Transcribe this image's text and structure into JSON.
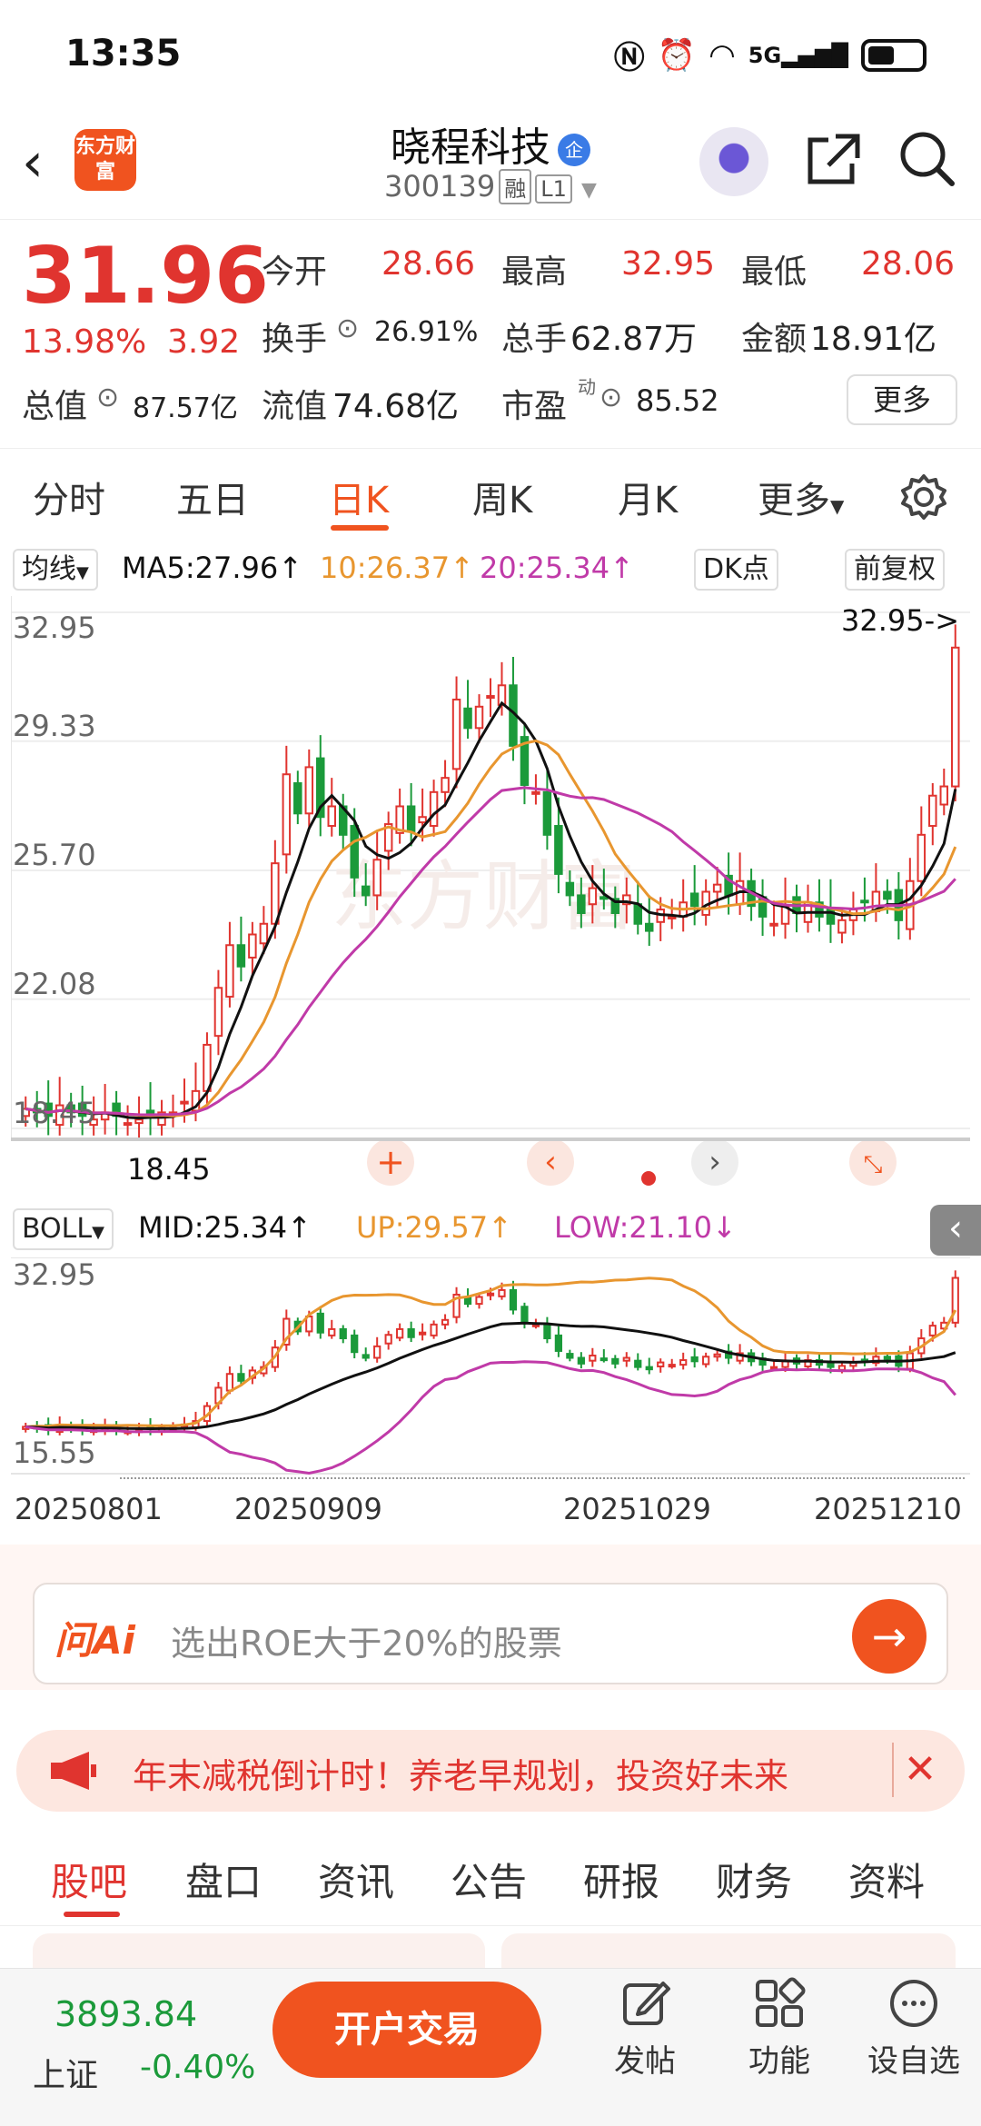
{
  "status_bar": {
    "time": "13:35",
    "icons": [
      "nfc-icon",
      "alarm-icon",
      "wifi-icon",
      "5g-signal-icon",
      "battery-icon"
    ],
    "network": "5G"
  },
  "header": {
    "logo_text": "东方财富",
    "name": "晓程科技",
    "name_badge": "企",
    "code": "300139",
    "tags": [
      "融",
      "L1"
    ]
  },
  "quote": {
    "price": "31.96",
    "change_pct": "13.98%",
    "change": "3.92",
    "fields": [
      {
        "label": "今开",
        "value": "28.66"
      },
      {
        "label": "最高",
        "value": "32.95"
      },
      {
        "label": "最低",
        "value": "28.06"
      },
      {
        "label": "换手",
        "value": "26.91%"
      },
      {
        "label": "总手",
        "value": "62.87万"
      },
      {
        "label": "金额",
        "value": "18.91亿"
      },
      {
        "label": "总值",
        "value": "87.57亿"
      },
      {
        "label": "流值",
        "value": "74.68亿"
      },
      {
        "label": "市盈",
        "sup": "动",
        "value": "85.52"
      }
    ],
    "more": "更多"
  },
  "period_tabs": [
    "分时",
    "五日",
    "日K",
    "周K",
    "月K",
    "更多"
  ],
  "active_period": "日K",
  "ma_bar": {
    "selector": "均线",
    "ma5": "MA5:27.96↑",
    "ma10": "10:26.37↑",
    "ma20": "20:25.34↑",
    "dk": "DK点",
    "adjust": "前复权"
  },
  "boll_bar": {
    "selector": "BOLL",
    "mid": "MID:25.34↑",
    "up": "UP:29.57↑",
    "low": "LOW:21.10↓"
  },
  "colors": {
    "up": "#e0342f",
    "down": "#1b9a3a",
    "ma5": "#111111",
    "ma10": "#e8962f",
    "ma20": "#c03aa8",
    "accent": "#f0531f"
  },
  "chart_data": [
    {
      "type": "candlestick",
      "title": "日K",
      "y_ticks": [
        "32.95",
        "29.33",
        "25.70",
        "22.08",
        "18.45"
      ],
      "ylim": [
        18.45,
        32.95
      ],
      "high_marker": "32.95->",
      "low_marker": "18.45",
      "watermark": "东方财富",
      "close": [
        19.0,
        18.9,
        18.8,
        19.1,
        18.9,
        18.8,
        18.7,
        18.9,
        18.8,
        18.6,
        18.7,
        18.8,
        18.9,
        18.9,
        19.2,
        19.5,
        20.8,
        22.4,
        23.6,
        23.0,
        23.9,
        24.2,
        25.9,
        28.4,
        27.3,
        28.6,
        27.2,
        27.5,
        26.7,
        25.5,
        25.0,
        26.0,
        27.0,
        27.5,
        26.8,
        27.2,
        27.9,
        28.3,
        30.5,
        29.7,
        30.3,
        30.6,
        30.9,
        29.2,
        28.1,
        27.9,
        26.7,
        25.6,
        25.0,
        24.5,
        25.2,
        24.9,
        24.5,
        25.0,
        24.2,
        24.0,
        24.6,
        24.4,
        24.8,
        24.7,
        25.1,
        25.3,
        25.0,
        25.4,
        24.7,
        24.4,
        24.2,
        24.7,
        24.5,
        24.8,
        24.4,
        24.2,
        24.3,
        24.6,
        24.8,
        25.1,
        24.9,
        24.3,
        25.4,
        26.7,
        27.8,
        28.06,
        31.96
      ],
      "ma_series": [
        {
          "name": "MA5"
        },
        {
          "name": "10"
        },
        {
          "name": "20"
        }
      ]
    },
    {
      "type": "line",
      "title": "BOLL",
      "y_ticks": [
        "32.95",
        "15.55"
      ],
      "ylim": [
        15.55,
        32.95
      ],
      "series": [
        {
          "name": "MID"
        },
        {
          "name": "UP"
        },
        {
          "name": "LOW"
        }
      ]
    }
  ],
  "date_axis": [
    "20250801",
    "20250909",
    "20251029",
    "20251210"
  ],
  "ai_search": {
    "logo": "问Ai",
    "placeholder": "选出ROE大于20%的股票"
  },
  "notice": {
    "text": "年末减税倒计时！养老早规划，投资好未来"
  },
  "section_tabs": [
    "股吧",
    "盘口",
    "资讯",
    "公告",
    "研报",
    "财务",
    "资料"
  ],
  "bottom_nav": {
    "index_value": "3893.84",
    "index_name": "上证",
    "index_change": "-0.40%",
    "trade": "开户交易",
    "items": [
      {
        "label": "发帖",
        "icon": "post-icon"
      },
      {
        "label": "功能",
        "icon": "grid-icon"
      },
      {
        "label": "设自选",
        "icon": "chat-icon"
      }
    ]
  }
}
